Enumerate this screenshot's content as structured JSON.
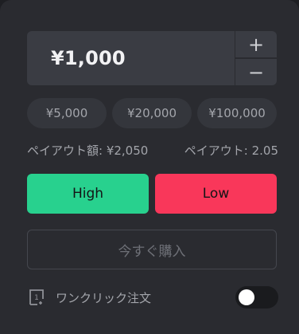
{
  "amount": {
    "value": "¥1,000",
    "increment_symbol": "+",
    "decrement_symbol": "−"
  },
  "presets": [
    "¥5,000",
    "¥20,000",
    "¥100,000"
  ],
  "payout": {
    "amount_text": "ペイアウト額: ¥2,050",
    "rate_text": "ペイアウト: 2.05"
  },
  "buttons": {
    "high_label": "High",
    "low_label": "Low",
    "buy_now_label": "今すぐ購入"
  },
  "one_click": {
    "label": "ワンクリック注文",
    "icon": "one-click-icon",
    "enabled": false
  },
  "colors": {
    "high": "#28d18e",
    "low": "#f9375a",
    "panel": "#2a2b30"
  }
}
